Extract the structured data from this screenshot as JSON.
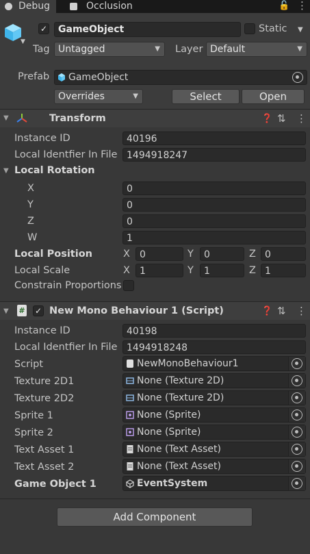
{
  "tabs": {
    "debug": "Debug",
    "occlusion": "Occlusion"
  },
  "game_object": {
    "name": "GameObject",
    "static_label": "Static",
    "tag_label": "Tag",
    "tag_value": "Untagged",
    "layer_label": "Layer",
    "layer_value": "Default",
    "prefab_label": "Prefab",
    "prefab_value": "GameObject",
    "overrides_label": "Overrides",
    "select_label": "Select",
    "open_label": "Open"
  },
  "transform": {
    "title": "Transform",
    "instance_id_label": "Instance ID",
    "instance_id": "40196",
    "local_identifier_label": "Local Identfier In File",
    "local_identifier": "1494918247",
    "local_rotation_label": "Local Rotation",
    "rot_x_label": "X",
    "rot_x": "0",
    "rot_y_label": "Y",
    "rot_y": "0",
    "rot_z_label": "Z",
    "rot_z": "0",
    "rot_w_label": "W",
    "rot_w": "1",
    "local_position_label": "Local Position",
    "pos_x": "0",
    "pos_y": "0",
    "pos_z": "0",
    "local_scale_label": "Local Scale",
    "scale_x": "1",
    "scale_y": "1",
    "scale_z": "1",
    "axis_x": "X",
    "axis_y": "Y",
    "axis_z": "Z",
    "constrain_label": "Constrain Proportions"
  },
  "script_component": {
    "title": "New Mono Behaviour 1 (Script)",
    "instance_id_label": "Instance ID",
    "instance_id": "40198",
    "local_identifier_label": "Local Identfier In File",
    "local_identifier": "1494918248",
    "fields": [
      {
        "label": "Script",
        "value": "NewMonoBehaviour1",
        "icon": "script-icon"
      },
      {
        "label": "Texture 2D1",
        "value": "None (Texture 2D)",
        "icon": "texture-icon"
      },
      {
        "label": "Texture 2D2",
        "value": "None (Texture 2D)",
        "icon": "texture-icon"
      },
      {
        "label": "Sprite 1",
        "value": "None (Sprite)",
        "icon": "sprite-icon"
      },
      {
        "label": "Sprite 2",
        "value": "None (Sprite)",
        "icon": "sprite-icon"
      },
      {
        "label": "Text Asset 1",
        "value": "None (Text Asset)",
        "icon": "text-asset-icon"
      },
      {
        "label": "Text Asset 2",
        "value": "None (Text Asset)",
        "icon": "text-asset-icon"
      },
      {
        "label": "Game Object 1",
        "value": "EventSystem",
        "icon": "gameobject-icon"
      }
    ]
  },
  "add_component_label": "Add Component"
}
